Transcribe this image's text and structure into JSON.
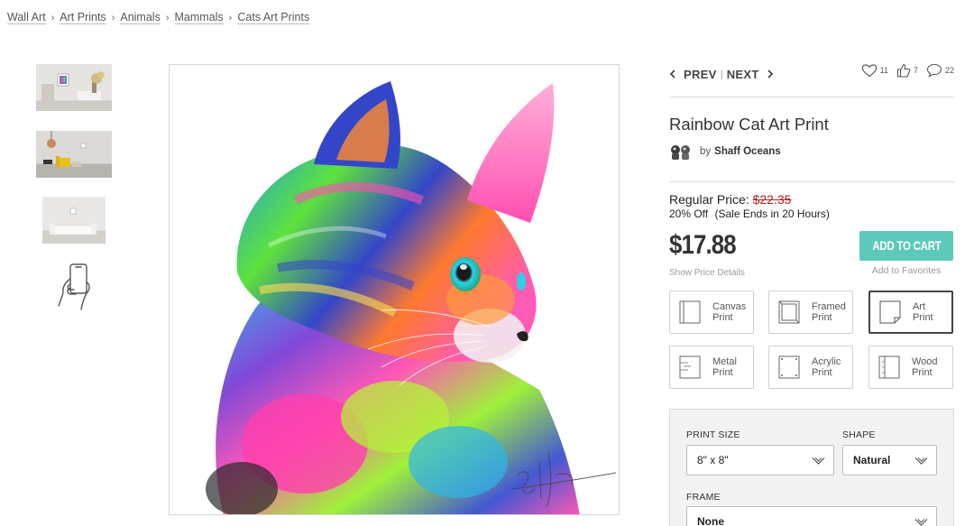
{
  "breadcrumb": [
    "Wall Art",
    "Art Prints",
    "Animals",
    "Mammals",
    "Cats Art Prints"
  ],
  "breadcrumb_separator": "›",
  "thumbnails": [
    "living-room-mockup",
    "lounge-chair-mockup",
    "sofa-mockup",
    "phone-ar-preview"
  ],
  "nav": {
    "prev": "PREV",
    "divider": "|",
    "next": "NEXT"
  },
  "counters": {
    "favorites": "11",
    "likes": "7",
    "comments": "22"
  },
  "product": {
    "title": "Rainbow Cat Art Print",
    "by": "by",
    "artist": "Shaff Oceans"
  },
  "pricing": {
    "regular_label": "Regular Price:",
    "regular_value": "$22.35",
    "discount": "20% Off",
    "sale_note": "(Sale Ends in 20 Hours)",
    "price": "$17.88",
    "details_link": "Show Price Details",
    "add_to_cart": "ADD TO CART",
    "add_to_favorites": "Add to Favorites"
  },
  "print_types": [
    {
      "label": "Canvas\nPrint",
      "selected": false
    },
    {
      "label": "Framed\nPrint",
      "selected": false
    },
    {
      "label": "Art\nPrint",
      "selected": true
    },
    {
      "label": "Metal\nPrint",
      "selected": false
    },
    {
      "label": "Acrylic\nPrint",
      "selected": false
    },
    {
      "label": "Wood\nPrint",
      "selected": false
    }
  ],
  "options": {
    "print_size_label": "PRINT SIZE",
    "print_size_value": "8\" x 8\"",
    "shape_label": "SHAPE",
    "shape_value": "Natural",
    "frame_label": "FRAME",
    "frame_value": "None"
  },
  "colors": {
    "accent": "#5dc9ba",
    "strike_price": "#b22222",
    "text": "#333333"
  }
}
